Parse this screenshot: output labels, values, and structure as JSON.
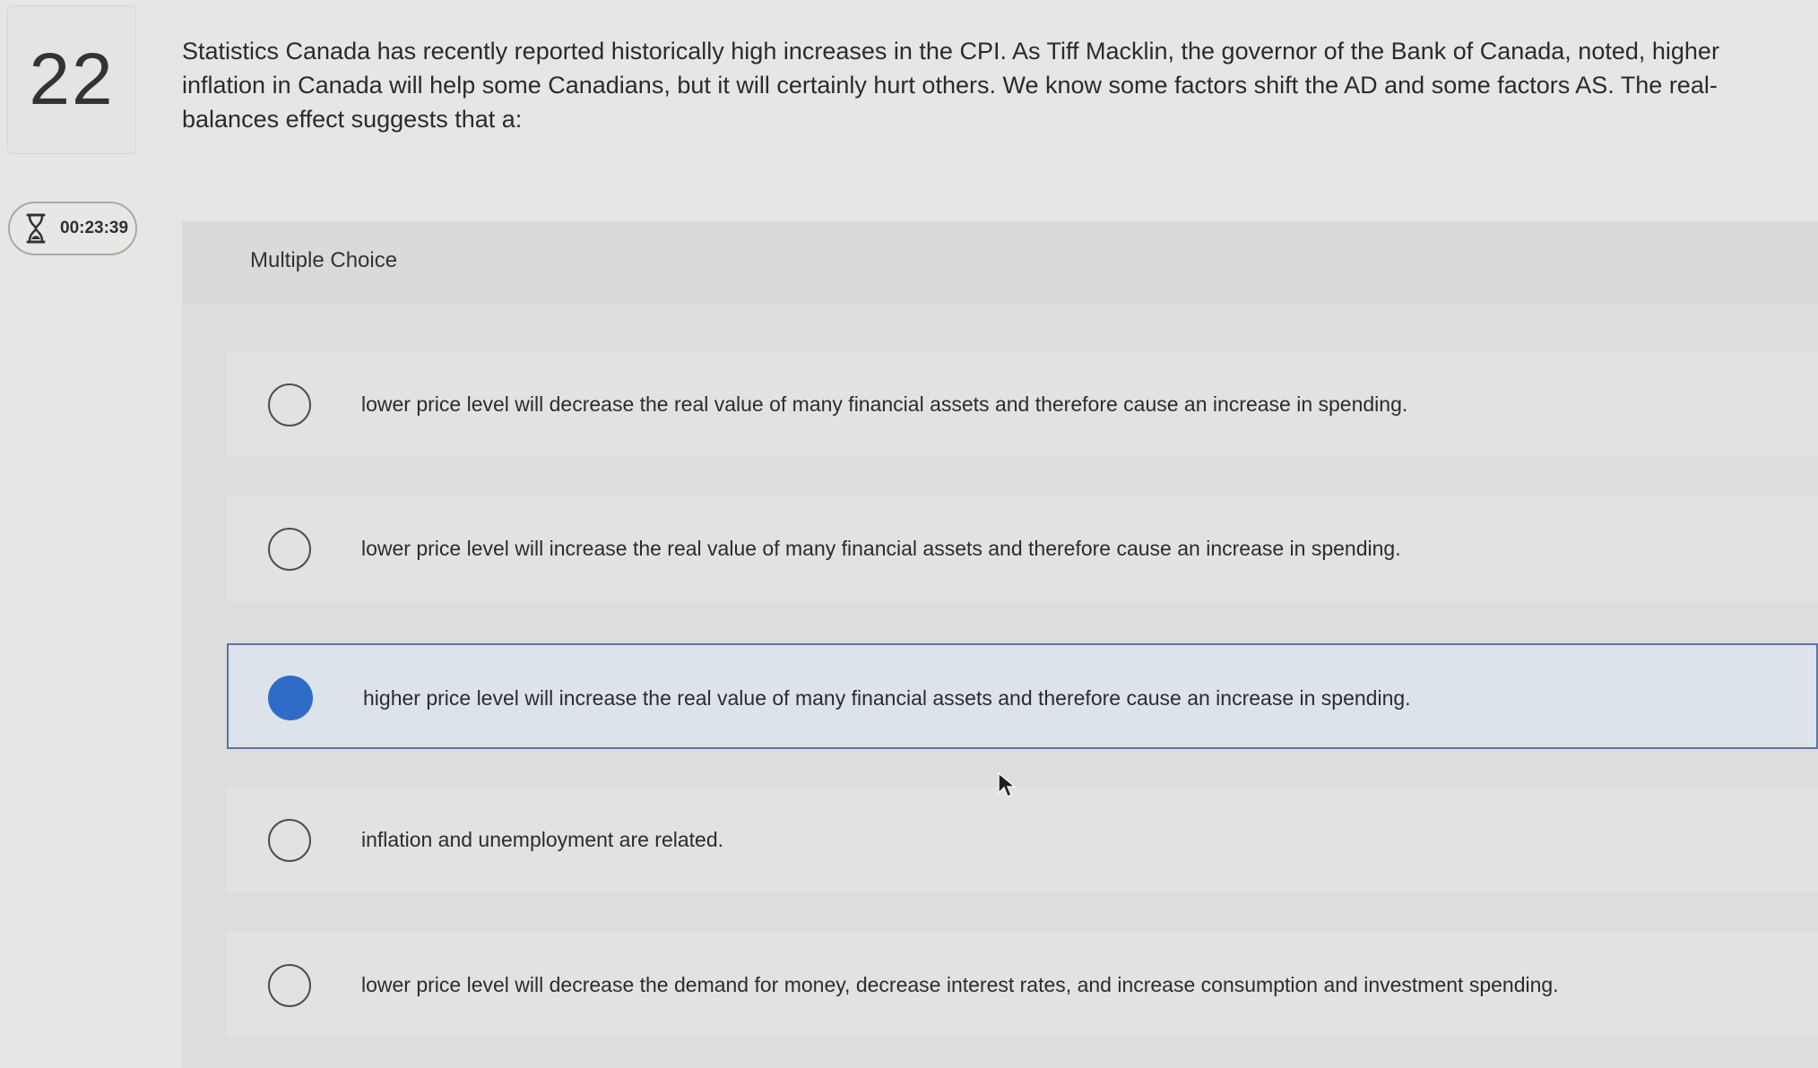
{
  "question_number": "22",
  "timer": {
    "value": "00:23:39",
    "icon": "hourglass-icon"
  },
  "question_text": "Statistics Canada has recently reported historically high increases in the CPI. As Tiff Macklin, the governor of the Bank of Canada, noted, higher inflation in Canada will help some Canadians, but it will certainly hurt others. We know some factors shift the AD and some factors AS. The real-balances effect suggests that a:",
  "question_type_label": "Multiple Choice",
  "options": [
    {
      "label": "lower price level will decrease the real value of many financial assets and therefore cause an increase in spending.",
      "selected": false
    },
    {
      "label": "lower price level will increase the real value of many financial assets and therefore cause an increase in spending.",
      "selected": false
    },
    {
      "label": "higher price level will increase the real value of many financial assets and therefore cause an increase in spending.",
      "selected": true
    },
    {
      "label": "inflation and unemployment are related.",
      "selected": false
    },
    {
      "label": "lower price level will decrease the demand for money, decrease interest rates, and increase consumption and investment spending.",
      "selected": false
    }
  ],
  "colors": {
    "selected_radio": "#2e6cc8",
    "selected_border": "#5a73a8"
  }
}
